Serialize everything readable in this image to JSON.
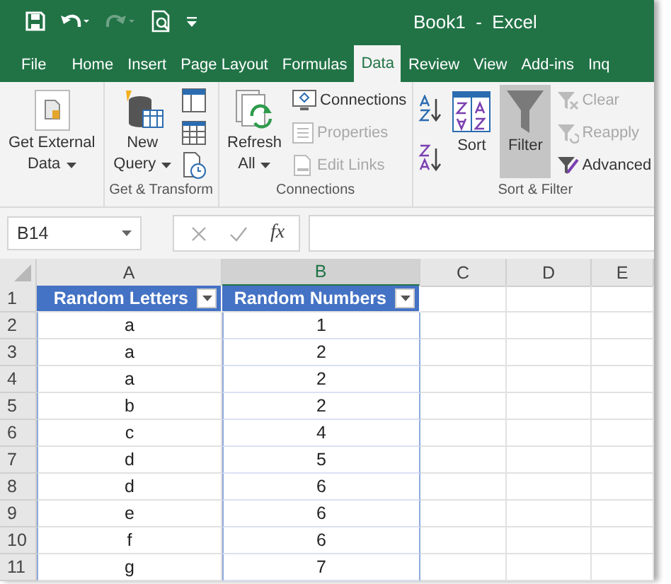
{
  "quick_access": [
    {
      "kind": "save",
      "disabled": false
    },
    {
      "kind": "undo",
      "disabled": false
    },
    {
      "kind": "redo",
      "disabled": true
    },
    {
      "kind": "preview",
      "disabled": false
    },
    {
      "kind": "customize",
      "disabled": false
    }
  ],
  "window": {
    "title": "Book1  -  Excel"
  },
  "tabs": [
    {
      "label": "File",
      "selected": false
    },
    {
      "label": "Home",
      "selected": false
    },
    {
      "label": "Insert",
      "selected": false
    },
    {
      "label": "Page Layout",
      "selected": false
    },
    {
      "label": "Formulas",
      "selected": false
    },
    {
      "label": "Data",
      "selected": true
    },
    {
      "label": "Review",
      "selected": false
    },
    {
      "label": "View",
      "selected": false
    },
    {
      "label": "Add-ins",
      "selected": false
    },
    {
      "label": "Inq",
      "selected": false
    }
  ],
  "ribbon": {
    "groups": [
      {
        "buttons": [
          {
            "kind": "large",
            "lines": [
              "Get External",
              "Data"
            ],
            "dropdown": true,
            "disabled": false,
            "selected": false
          }
        ]
      },
      {
        "label": "Get & Transform",
        "buttons": [
          {
            "kind": "large",
            "lines": [
              "New",
              "Query"
            ],
            "dropdown": true,
            "disabled": false,
            "selected": false
          },
          {
            "kind": "icon",
            "disabled": false,
            "selected": false
          },
          {
            "kind": "icon",
            "disabled": false,
            "selected": false
          },
          {
            "kind": "icon",
            "disabled": false,
            "selected": false
          }
        ]
      },
      {
        "label": "Connections",
        "buttons": [
          {
            "kind": "large",
            "lines": [
              "Refresh",
              "All"
            ],
            "dropdown": true,
            "disabled": false,
            "selected": false
          },
          {
            "kind": "small",
            "lines": [
              "Connections"
            ],
            "disabled": false,
            "selected": false
          },
          {
            "kind": "small",
            "lines": [
              "Properties"
            ],
            "disabled": true,
            "selected": false
          },
          {
            "kind": "small",
            "lines": [
              "Edit Links"
            ],
            "disabled": true,
            "selected": false
          }
        ]
      },
      {
        "label": "Sort & Filter",
        "buttons": [
          {
            "kind": "icon",
            "disabled": false,
            "selected": false
          },
          {
            "kind": "icon",
            "disabled": false,
            "selected": false
          },
          {
            "kind": "large",
            "lines": [
              "Sort"
            ],
            "dropdown": false,
            "disabled": false,
            "selected": false
          },
          {
            "kind": "large",
            "lines": [
              "Filter"
            ],
            "dropdown": false,
            "disabled": false,
            "selected": true
          },
          {
            "kind": "small",
            "lines": [
              "Clear"
            ],
            "disabled": true,
            "selected": false
          },
          {
            "kind": "small",
            "lines": [
              "Reapply"
            ],
            "disabled": true,
            "selected": false
          },
          {
            "kind": "small",
            "lines": [
              "Advanced"
            ],
            "disabled": false,
            "selected": false
          }
        ]
      }
    ]
  },
  "formula_bar": {
    "name_box": "B14",
    "function_label": "fx"
  },
  "grid": {
    "columns": [
      {
        "label": "A",
        "selected": false
      },
      {
        "label": "B",
        "selected": true
      },
      {
        "label": "C",
        "selected": false
      },
      {
        "label": "D",
        "selected": false
      },
      {
        "label": "E",
        "selected": false
      }
    ],
    "row_numbers": [
      "1",
      "2",
      "3",
      "4",
      "5",
      "6",
      "7",
      "8",
      "9",
      "10",
      "11"
    ]
  },
  "table": {
    "columns": [
      {
        "label": "Random Letters",
        "filter": true
      },
      {
        "label": "Random Numbers",
        "filter": true
      }
    ],
    "rows": [
      [
        "a",
        "1"
      ],
      [
        "a",
        "2"
      ],
      [
        "a",
        "2"
      ],
      [
        "b",
        "2"
      ],
      [
        "c",
        "4"
      ],
      [
        "d",
        "5"
      ],
      [
        "d",
        "6"
      ],
      [
        "e",
        "6"
      ],
      [
        "f",
        "6"
      ],
      [
        "g",
        "7"
      ]
    ]
  }
}
